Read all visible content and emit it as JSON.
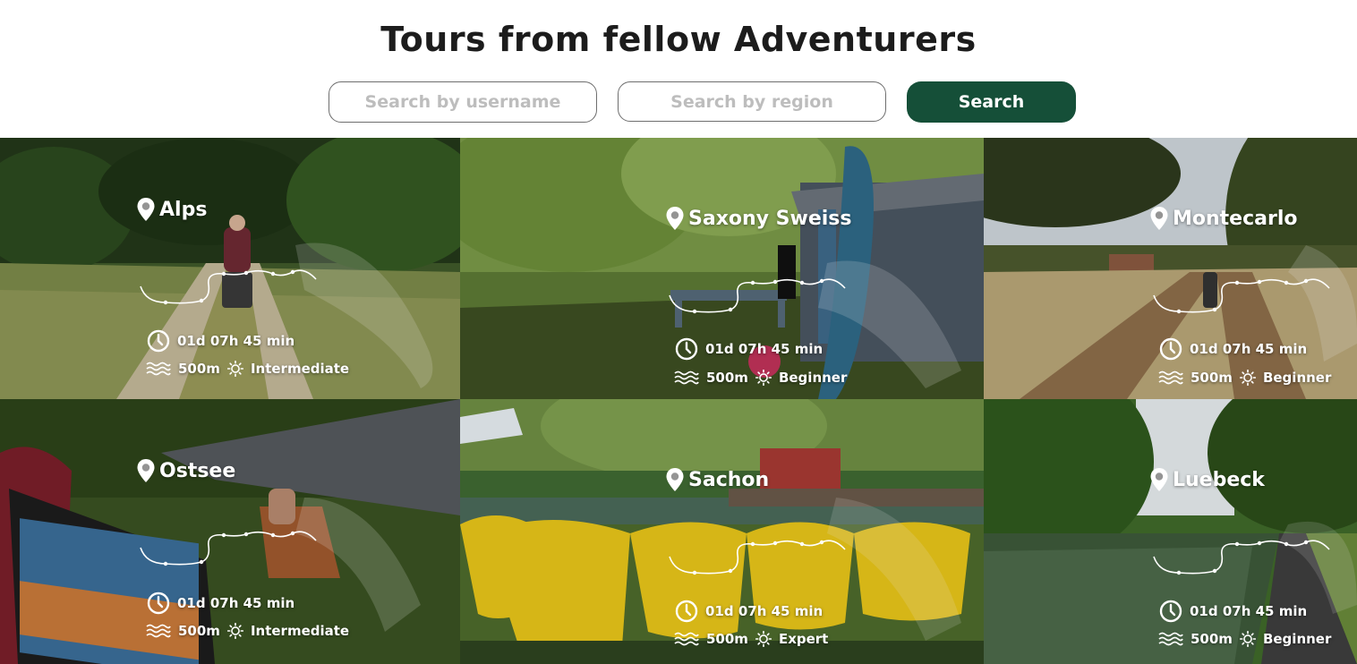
{
  "header": {
    "title": "Tours from fellow Adventurers"
  },
  "search": {
    "username_placeholder": "Search by username",
    "region_placeholder": "Search by region",
    "button_label": "Search"
  },
  "colors": {
    "brand_green": "#154f38",
    "selected_outline": "#2f77c8"
  },
  "tours": [
    {
      "title": "Alps",
      "duration": "01d 07h 45 min",
      "elevation": "500m",
      "difficulty": "Intermediate",
      "selected": true
    },
    {
      "title": "Saxony Sweiss",
      "duration": "01d 07h 45 min",
      "elevation": "500m",
      "difficulty": "Beginner"
    },
    {
      "title": "Montecarlo",
      "duration": "01d 07h 45 min",
      "elevation": "500m",
      "difficulty": "Beginner"
    },
    {
      "title": "Ostsee",
      "duration": "01d 07h 45 min",
      "elevation": "500m",
      "difficulty": "Intermediate"
    },
    {
      "title": "Sachon",
      "duration": "01d 07h 45 min",
      "elevation": "500m",
      "difficulty": "Expert"
    },
    {
      "title": "Luebeck",
      "duration": "01d 07h 45 min",
      "elevation": "500m",
      "difficulty": "Beginner"
    }
  ],
  "icons": {
    "location": "map-pin-icon",
    "duration": "clock-icon",
    "elevation": "waves-icon",
    "difficulty": "sun-icon"
  }
}
